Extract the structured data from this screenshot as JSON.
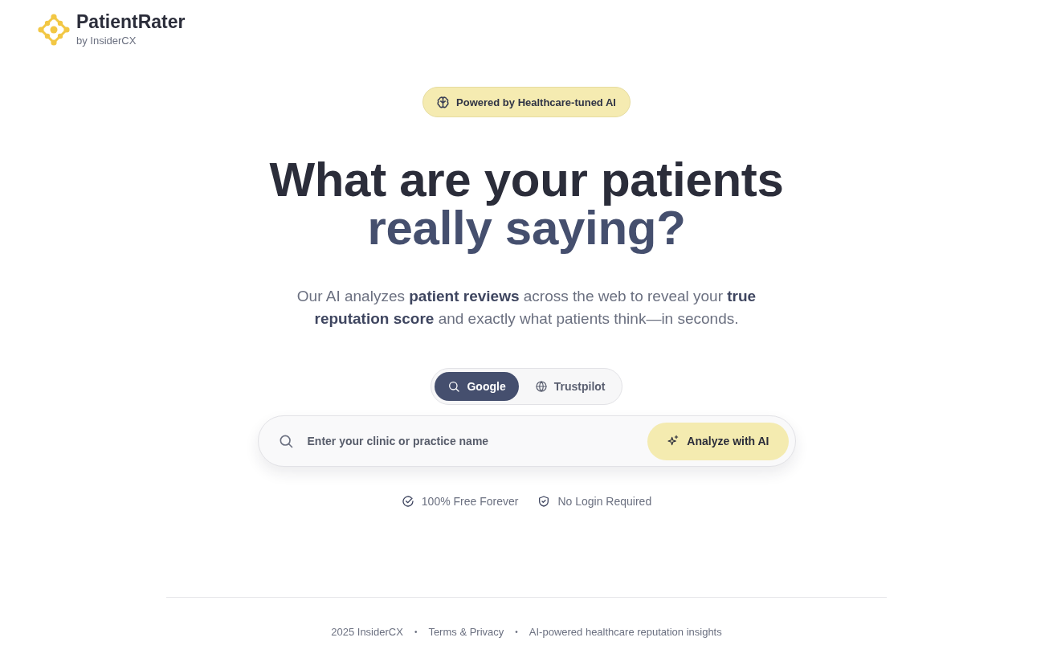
{
  "header": {
    "brand": "PatientRater",
    "byline": "by InsiderCX"
  },
  "badge": {
    "label": "Powered by Healthcare-tuned AI"
  },
  "hero": {
    "headline": "What are your patients",
    "headline_accent": "really saying?",
    "subtitle": "Our AI analyzes **patient reviews** across the web to reveal your **true reputation score** and exactly what patients think—in seconds."
  },
  "source_tabs": [
    {
      "label": "Google",
      "selected": true
    },
    {
      "label": "Trustpilot",
      "selected": false
    }
  ],
  "search": {
    "placeholder": "Enter your clinic or practice name",
    "button": "Analyze with AI"
  },
  "features": [
    "100% Free Forever",
    "No Login Required"
  ],
  "footer": {
    "items": [
      "2025 InsiderCX",
      "Terms & Privacy",
      "AI-powered healthcare reputation insights"
    ],
    "separator": "•"
  }
}
